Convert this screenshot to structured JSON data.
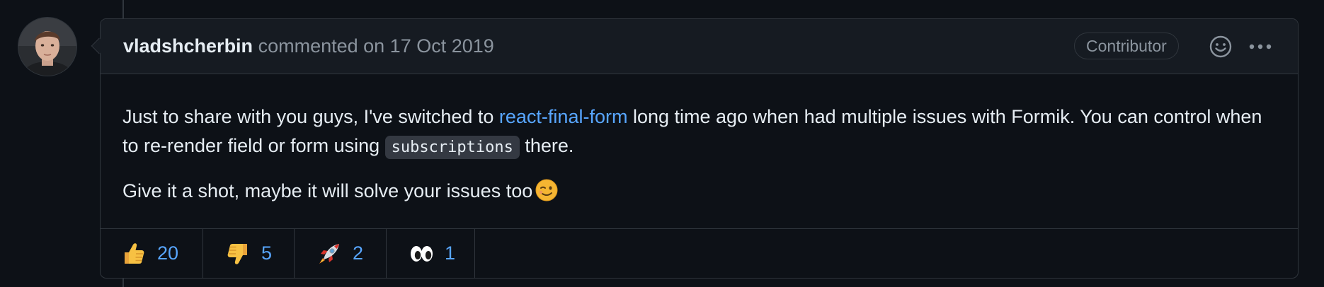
{
  "comment": {
    "author": "vladshcherbin",
    "meta": "commented on 17 Oct 2019",
    "role": "Contributor",
    "body": {
      "p1_text1": "Just to share with you guys, I've switched to ",
      "p1_link": "react-final-form",
      "p1_text2": " long time ago when had multiple issues with Formik. You can control when to re-render field or form using ",
      "p1_code": "subscriptions",
      "p1_text3": " there.",
      "p2_text": "Give it a shot, maybe it will solve your issues too"
    }
  },
  "reactions": [
    {
      "icon": "thumbs-up-icon",
      "count": "20"
    },
    {
      "icon": "thumbs-down-icon",
      "count": "5"
    },
    {
      "icon": "rocket-icon",
      "count": "2"
    },
    {
      "icon": "eyes-icon",
      "count": "1"
    }
  ],
  "colors": {
    "background": "#0d1117",
    "header_bg": "#161b22",
    "border": "#30363d",
    "link": "#58a6ff",
    "muted": "#8b949e",
    "text": "#e6edf3"
  }
}
